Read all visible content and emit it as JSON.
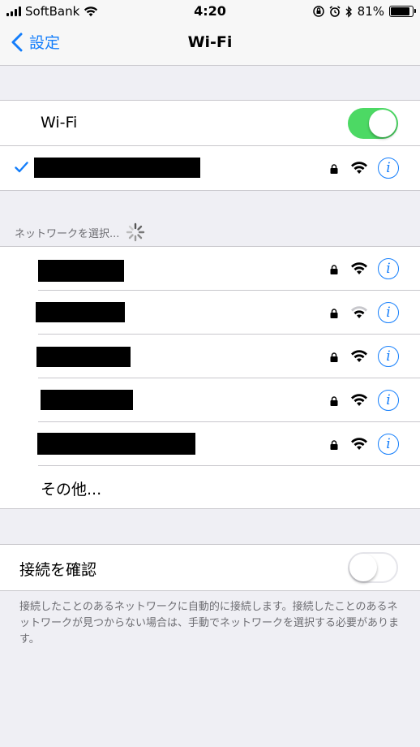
{
  "status": {
    "carrier": "SoftBank",
    "time": "4:20",
    "battery": "81%",
    "battery_level": 0.81
  },
  "nav": {
    "back_label": "設定",
    "title": "Wi-Fi"
  },
  "wifi_toggle": {
    "label": "Wi-Fi",
    "on": true
  },
  "section_header": "ネットワークを選択...",
  "other_label": "その他...",
  "ask_join": {
    "label": "接続を確認",
    "on": false
  },
  "footer_note": "接続したことのあるネットワークに自動的に接続します。接続したことのあるネットワークが見つからない場合は、手動でネットワークを選択する必要があります。",
  "icons": {
    "back": "chevron-left-icon",
    "lock": "lock-icon",
    "wifi": "wifi-icon",
    "info": "info-icon",
    "check": "checkmark-icon",
    "spinner": "spinner-icon"
  },
  "colors": {
    "accent": "#147efb",
    "toggle_on": "#4cd964"
  },
  "info_glyph": "i"
}
